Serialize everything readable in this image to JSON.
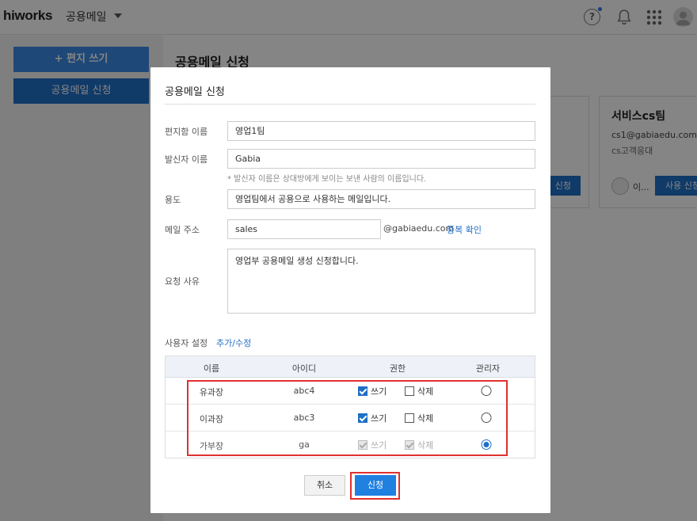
{
  "topbar": {
    "logo": "hiworks",
    "app_name": "공용메일",
    "help_glyph": "?",
    "icons": [
      "help-icon",
      "bell-icon",
      "apps-grid-icon",
      "user-avatar-icon"
    ]
  },
  "sidebar": {
    "write_button": "+ 편지 쓰기",
    "apply_button": "공용메일 신청"
  },
  "main": {
    "title": "공용메일 신청",
    "cards": [
      {
        "button": "신청"
      },
      {
        "title": "서비스cs팀",
        "email": "cs1@gabiaedu.com",
        "description": "cs고객응대",
        "member": "이...",
        "button": "사용 신청"
      }
    ]
  },
  "modal": {
    "title": "공용메일 신청",
    "fields": {
      "mailbox_name": {
        "label": "편지함 이름",
        "value": "영업1팀"
      },
      "sender_name": {
        "label": "발신자 이름",
        "value": "Gabia",
        "hint": "* 발신자 이름은 상대방에게 보이는 보낸 사람의 이름입니다."
      },
      "purpose": {
        "label": "용도",
        "value": "영업팀에서 공용으로 사용하는 메일입니다."
      },
      "email": {
        "label": "메일 주소",
        "value": "sales",
        "domain": "@gabiaedu.com",
        "check_link": "중복 확인"
      },
      "reason": {
        "label": "요청 사유",
        "value": "영업부 공용메일 생성 신청합니다."
      }
    },
    "users": {
      "label": "사용자 설정",
      "edit_link": "추가/수정",
      "columns": [
        "이름",
        "아이디",
        "권한",
        "관리자"
      ],
      "rows": [
        {
          "name": "유과장",
          "id": "abc4",
          "write_label": "쓰기",
          "delete_label": "삭제",
          "write": true,
          "delete": false,
          "admin": false,
          "disabled": false
        },
        {
          "name": "이과장",
          "id": "abc3",
          "write_label": "쓰기",
          "delete_label": "삭제",
          "write": true,
          "delete": false,
          "admin": false,
          "disabled": false
        },
        {
          "name": "가부장",
          "id": "ga",
          "write_label": "쓰기",
          "delete_label": "삭제",
          "write": true,
          "delete": true,
          "admin": true,
          "disabled": true
        }
      ]
    },
    "cancel_button": "취소",
    "submit_button": "신청"
  },
  "colors": {
    "accent": "#1f6fc7",
    "submit": "#1f80e0",
    "highlight": "#e03030"
  }
}
